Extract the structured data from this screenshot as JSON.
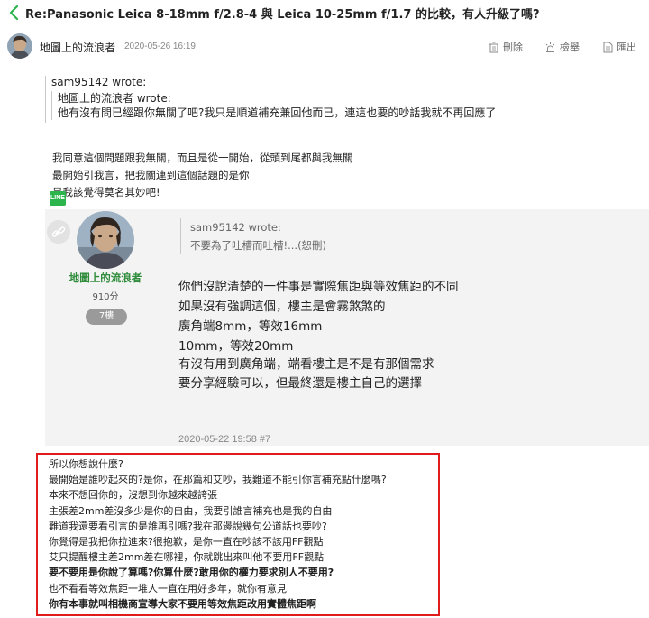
{
  "header": {
    "title": "Re:Panasonic Leica 8-18mm f/2.8-4 與 Leica 10-25mm f/1.7 的比較，有人升級了嗎?"
  },
  "post_meta": {
    "author": "地圖上的流浪者",
    "date": "2020-05-26 16:19",
    "actions": {
      "delete": "刪除",
      "report": "檢舉",
      "export": "匯出"
    }
  },
  "quote": {
    "outer_author": "sam95142 wrote:",
    "inner_author": "地圖上的流浪者 wrote:",
    "inner_text": "他有沒有問已經跟你無關了吧?我只是順道補充兼回他而已，連這也要的吵話我就不再回應了"
  },
  "reply_lines": [
    "我同意這個問題跟我無關，而且是從一開始，從頭到尾都與我無關",
    "最開始引我言，把我關連到這個話題的是你",
    "是我該覺得莫名其妙吧!"
  ],
  "embedded_post": {
    "line_badge": "LINE",
    "nickname": "地圖上的流浪者",
    "points": "910分",
    "floor": "7樓",
    "quote_author": "sam95142 wrote:",
    "quote_text": "不要為了吐槽而吐槽!...(恕刪)",
    "body_lines": [
      "你們沒說清楚的一件事是實際焦距與等效焦距的不同",
      "如果沒有強調這個，樓主是會霧煞煞的",
      "廣角端8mm，等效16mm",
      "10mm，等效20mm",
      "有沒有用到廣角端，端看樓主是不是有那個需求",
      "要分享經驗可以，但最終還是樓主自己的選擇"
    ],
    "stamp": "2020-05-22 19:58 #7"
  },
  "boxed_lines": [
    {
      "text": "所以你想說什麼?",
      "bold": false
    },
    {
      "text": "最開始是誰吵起來的?是你，在那篇和艾吵，我難道不能引你言補充點什麼嗎?",
      "bold": false
    },
    {
      "text": "本來不想回你的，沒想到你越來越誇張",
      "bold": false
    },
    {
      "text": "主張差2mm差沒多少是你的自由，我要引誰言補充也是我的自由",
      "bold": false
    },
    {
      "text": "難道我還要看引言的是誰再引嗎?我在那邊說幾句公道話也要吵?",
      "bold": false
    },
    {
      "text": "你覺得是我把你拉進來?很抱歉，是你一直在吵該不該用FF觀點",
      "bold": false
    },
    {
      "text": "艾只提醒樓主差2mm差在哪裡，你就跳出來叫他不要用FF觀點",
      "bold": false
    },
    {
      "text": "要不要用是你說了算嗎?你算什麼?敢用你的權力要求別人不要用?",
      "bold": true
    },
    {
      "text": "也不看看等效焦距一堆人一直在用好多年，就你有意見",
      "bold": false
    },
    {
      "text": "你有本事就叫相機商宣導大家不要用等效焦距改用實體焦距啊",
      "bold": true
    }
  ],
  "colors": {
    "accent_green": "#2e8b3a",
    "highlight_border": "#e01b1b",
    "muted_text": "#888888"
  }
}
